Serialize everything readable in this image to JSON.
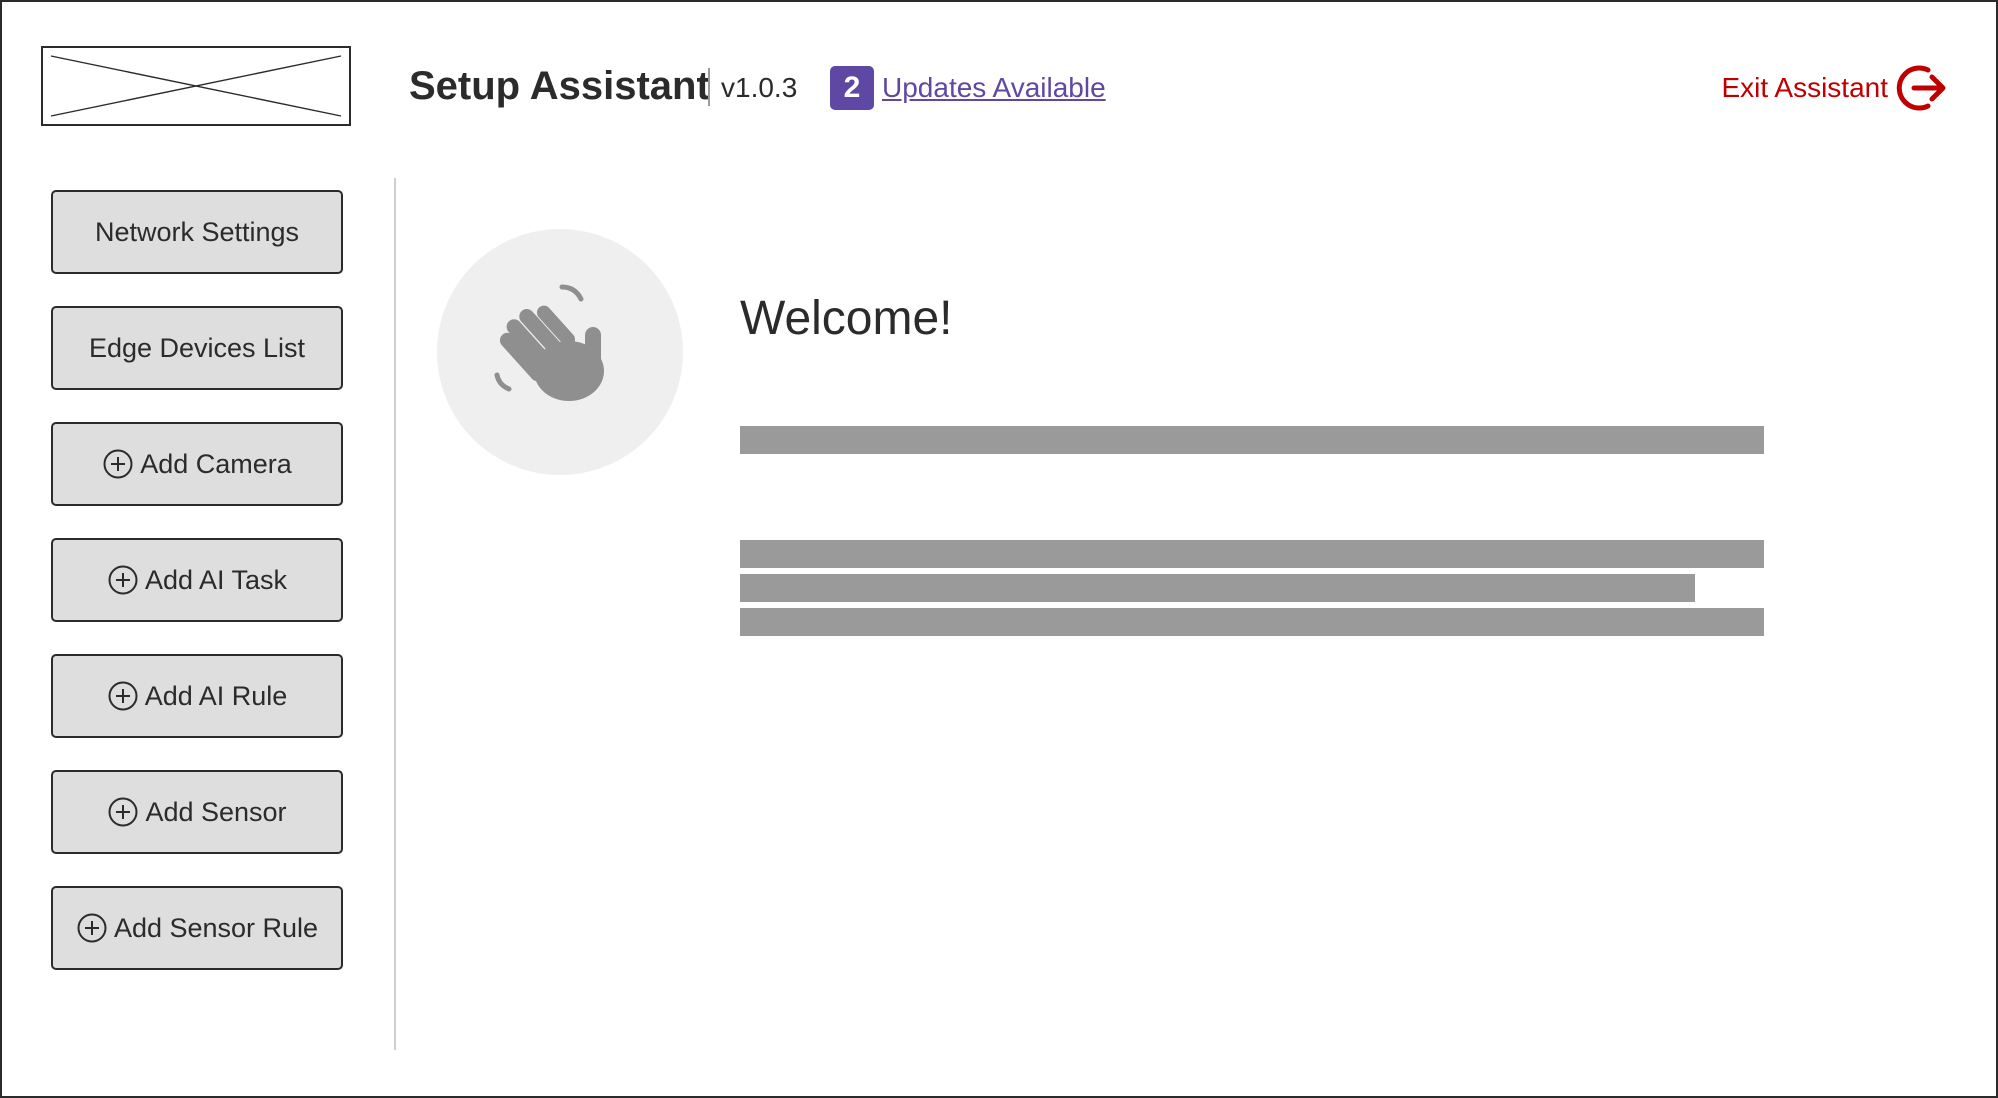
{
  "header": {
    "title": "Setup Assistant",
    "version": "v1.0.3",
    "updates_count": "2",
    "updates_label": "Updates Available",
    "exit_label": "Exit Assistant"
  },
  "sidebar": {
    "items": [
      {
        "label": "Network Settings",
        "icon": null
      },
      {
        "label": "Edge Devices List",
        "icon": null
      },
      {
        "label": "Add Camera",
        "icon": "plus-circle-icon"
      },
      {
        "label": "Add AI Task",
        "icon": "plus-circle-icon"
      },
      {
        "label": "Add AI Rule",
        "icon": "plus-circle-icon"
      },
      {
        "label": "Add Sensor",
        "icon": "plus-circle-icon"
      },
      {
        "label": "Add Sensor Rule",
        "icon": "plus-circle-icon"
      }
    ]
  },
  "main": {
    "heading": "Welcome!",
    "avatar_icon": "waving-hand-icon"
  },
  "colors": {
    "accent": "#5e48a3",
    "exit": "#c00000",
    "button_bg": "#dedede",
    "placeholder": "#9a9a9a"
  }
}
